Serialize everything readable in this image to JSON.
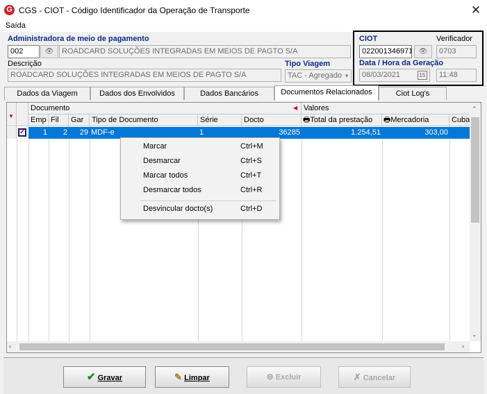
{
  "window": {
    "title": "CGS - CIOT - Código Identificador da Operação de Transporte",
    "menu": [
      "Saída"
    ]
  },
  "admin": {
    "label": "Administradora de meio de pagamento",
    "code": "002",
    "name": "ROADCARD SOLUÇÕES INTEGRADAS EM MEIOS DE PAGTO S/A"
  },
  "descricao": {
    "label": "Descrição",
    "value": "ROADCARD SOLUÇÕES INTEGRADAS EM MEIOS DE PAGTO S/A"
  },
  "tipo_viagem": {
    "label": "Tipo Viagem",
    "value": "TAC - Agregado"
  },
  "ciot": {
    "label": "CIOT",
    "value": "022001346971",
    "verificador_label": "Verificador",
    "verificador": "0703",
    "data_label": "Data / Hora da Geração",
    "data": "08/03/2021",
    "hora": "11:48",
    "cal_glyph": "15"
  },
  "tabs": [
    "Dados da Viagem",
    "Dados dos Envolvidos",
    "Dados Bancários",
    "Documentos Relacionados",
    "Ciot Log's"
  ],
  "grid": {
    "group_documento": "Documento",
    "group_valores": "Valores",
    "columns": [
      "Emp",
      "Fil",
      "Gar",
      "Tipo de Documento",
      "Série",
      "Docto",
      "Total da prestação",
      "Mercadoria",
      "Cubag"
    ],
    "rows": [
      {
        "emp": "1",
        "fil": "2",
        "gar": "29",
        "tipo": "MDF-e",
        "serie": "1",
        "docto": "36285",
        "total": "1.254,51",
        "mercadoria": "303,00",
        "cubag": ""
      }
    ]
  },
  "context_menu": [
    {
      "label": "Marcar",
      "shortcut": "Ctrl+M"
    },
    {
      "label": "Desmarcar",
      "shortcut": "Ctrl+S"
    },
    {
      "label": "Marcar todos",
      "shortcut": "Ctrl+T"
    },
    {
      "label": "Desmarcar todos",
      "shortcut": "Ctrl+R"
    },
    {
      "label": "Desvincular docto(s)",
      "shortcut": "Ctrl+D"
    }
  ],
  "buttons": {
    "gravar": "Gravar",
    "limpar": "Limpar",
    "excluir": "Excluir",
    "cancelar": "Cancelar"
  },
  "colors": {
    "selection": "#0078d7",
    "label_blue": "#0a2a8c",
    "logo": "#c8232c",
    "checkbox_red": "#d0021b"
  }
}
